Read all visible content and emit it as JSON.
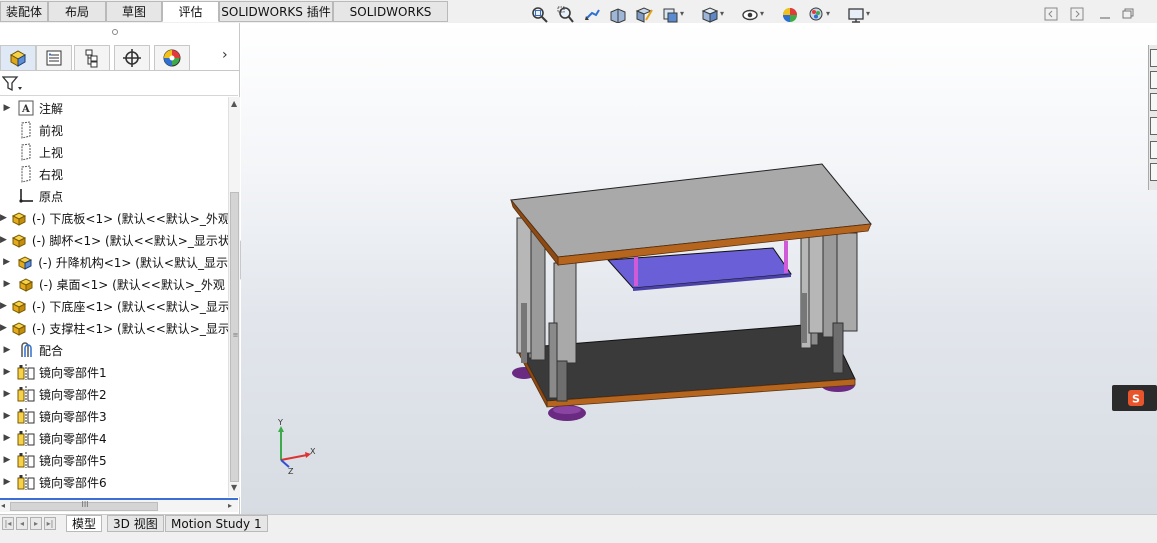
{
  "tabs": [
    "装配体",
    "布局",
    "草图",
    "评估",
    "SOLIDWORKS 插件",
    "SOLIDWORKS MBD"
  ],
  "active_tab": "评估",
  "feature_tree": {
    "items": [
      {
        "label": "注解",
        "icon": "annotations-icon",
        "expandable": true
      },
      {
        "label": "前视",
        "icon": "plane-icon",
        "expandable": false
      },
      {
        "label": "上视",
        "icon": "plane-icon",
        "expandable": false
      },
      {
        "label": "右视",
        "icon": "plane-icon",
        "expandable": false
      },
      {
        "label": "原点",
        "icon": "origin-icon",
        "expandable": false
      },
      {
        "label": "(-) 下底板<1> (默认<<默认>_外观",
        "icon": "part-icon",
        "expandable": true
      },
      {
        "label": "(-) 脚杯<1> (默认<<默认>_显示状",
        "icon": "part-icon",
        "expandable": true
      },
      {
        "label": "(-) 升降机构<1> (默认<默认_显示",
        "icon": "subassembly-icon",
        "expandable": true
      },
      {
        "label": "(-) 桌面<1> (默认<<默认>_外观",
        "icon": "part-icon",
        "expandable": true
      },
      {
        "label": "(-) 下底座<1> (默认<<默认>_显示",
        "icon": "part-icon",
        "expandable": true
      },
      {
        "label": "(-) 支撑柱<1> (默认<<默认>_显示",
        "icon": "part-icon",
        "expandable": true
      },
      {
        "label": "配合",
        "icon": "mates-icon",
        "expandable": true
      },
      {
        "label": "镜向零部件1",
        "icon": "mirror-component-icon",
        "expandable": true
      },
      {
        "label": "镜向零部件2",
        "icon": "mirror-component-icon",
        "expandable": true
      },
      {
        "label": "镜向零部件3",
        "icon": "mirror-component-icon",
        "expandable": true
      },
      {
        "label": "镜向零部件4",
        "icon": "mirror-component-icon",
        "expandable": true
      },
      {
        "label": "镜向零部件5",
        "icon": "mirror-component-icon",
        "expandable": true
      },
      {
        "label": "镜向零部件6",
        "icon": "mirror-component-icon",
        "expandable": true
      }
    ]
  },
  "scrollbar_grip": "III",
  "bottom_tabs": [
    "模型",
    "3D 视图",
    "Motion Study 1"
  ],
  "active_bottom_tab": "模型",
  "triad": {
    "x": "X",
    "y": "Y",
    "z": "Z"
  },
  "hud_icons": [
    "zoom-to-fit-icon",
    "zoom-to-area-icon",
    "previous-view-icon",
    "section-view-icon",
    "dynamic-annotation-icon",
    "view-orientation-icon",
    "display-style-icon",
    "hide-show-icon",
    "edit-appearance-icon",
    "apply-scene-icon",
    "view-settings-icon"
  ],
  "colors": {
    "tabletop": "#a9a9a9",
    "table_edge": "#b5651d",
    "bottom_plate": "#3a3a3a",
    "lift_panel": "#6a5fd6",
    "leg": "#b7b7b7",
    "foot": "#6a2a82"
  }
}
